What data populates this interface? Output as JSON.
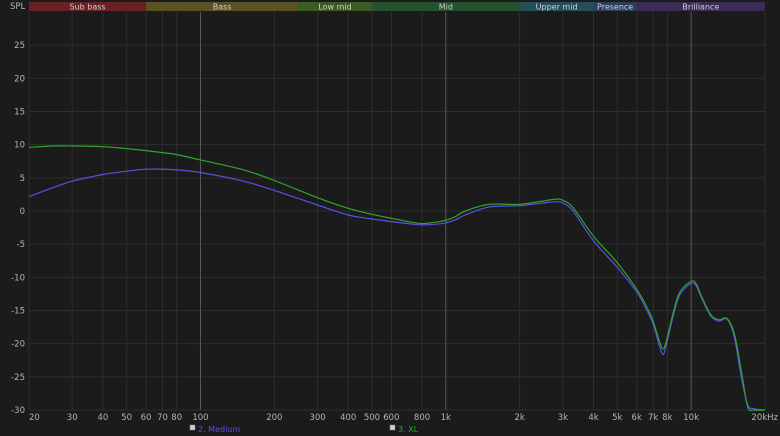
{
  "chart_data": {
    "type": "line",
    "ylabel": "SPL",
    "xscale": "log",
    "xlim": [
      20,
      20000
    ],
    "ylim": [
      -30,
      30
    ],
    "grid": true,
    "bands": [
      {
        "name": "Sub bass",
        "from": 20,
        "to": 60,
        "color": "#6b2026"
      },
      {
        "name": "Bass",
        "from": 60,
        "to": 250,
        "color": "#5a5222"
      },
      {
        "name": "Low mid",
        "from": 250,
        "to": 500,
        "color": "#3b5a24"
      },
      {
        "name": "Mid",
        "from": 500,
        "to": 2000,
        "color": "#24522f"
      },
      {
        "name": "Upper mid",
        "from": 2000,
        "to": 4000,
        "color": "#244f58"
      },
      {
        "name": "Presence",
        "from": 4000,
        "to": 6000,
        "color": "#2b3e5e"
      },
      {
        "name": "Brilliance",
        "from": 6000,
        "to": 20000,
        "color": "#3c2b55"
      }
    ],
    "y_ticks": [
      {
        "value": 25,
        "label": "25"
      },
      {
        "value": 20,
        "label": "20"
      },
      {
        "value": 15,
        "label": "15"
      },
      {
        "value": 10,
        "label": "10"
      },
      {
        "value": 5,
        "label": "5"
      },
      {
        "value": 0,
        "label": "0"
      },
      {
        "value": -5,
        "label": "-5"
      },
      {
        "value": -10,
        "label": "-10"
      },
      {
        "value": -15,
        "label": "-15"
      },
      {
        "value": -20,
        "label": "-20"
      },
      {
        "value": -25,
        "label": "-25"
      },
      {
        "value": -30,
        "label": "-30"
      }
    ],
    "x_ticks": [
      {
        "value": 20,
        "label": "20",
        "major": false
      },
      {
        "value": 30,
        "label": "30",
        "major": false
      },
      {
        "value": 40,
        "label": "40",
        "major": false
      },
      {
        "value": 50,
        "label": "50",
        "major": false
      },
      {
        "value": 60,
        "label": "60",
        "major": false
      },
      {
        "value": 70,
        "label": "70",
        "major": false
      },
      {
        "value": 80,
        "label": "80",
        "major": false
      },
      {
        "value": 100,
        "label": "100",
        "major": true
      },
      {
        "value": 200,
        "label": "200",
        "major": false
      },
      {
        "value": 300,
        "label": "300",
        "major": false
      },
      {
        "value": 400,
        "label": "400",
        "major": false
      },
      {
        "value": 500,
        "label": "500",
        "major": false
      },
      {
        "value": 600,
        "label": "600",
        "major": false
      },
      {
        "value": 800,
        "label": "800",
        "major": false
      },
      {
        "value": 1000,
        "label": "1k",
        "major": true
      },
      {
        "value": 2000,
        "label": "2k",
        "major": false
      },
      {
        "value": 3000,
        "label": "3k",
        "major": false
      },
      {
        "value": 4000,
        "label": "4k",
        "major": false
      },
      {
        "value": 5000,
        "label": "5k",
        "major": false
      },
      {
        "value": 6000,
        "label": "6k",
        "major": false
      },
      {
        "value": 7000,
        "label": "7k",
        "major": false
      },
      {
        "value": 8000,
        "label": "8k",
        "major": false
      },
      {
        "value": 10000,
        "label": "10k",
        "major": true
      },
      {
        "value": 20000,
        "label": "20kHz",
        "major": false
      }
    ],
    "series": [
      {
        "name": "2. Medium",
        "color": "#5b4fe0",
        "x": [
          20,
          25,
          30,
          40,
          50,
          60,
          70,
          80,
          100,
          150,
          200,
          300,
          400,
          500,
          600,
          700,
          800,
          900,
          1000,
          1100,
          1200,
          1500,
          2000,
          2500,
          2800,
          3000,
          3300,
          4000,
          5000,
          6000,
          6500,
          7000,
          7400,
          7700,
          8000,
          8500,
          9000,
          10000,
          10500,
          11000,
          12000,
          13000,
          14000,
          15000,
          16000,
          17000,
          18000,
          20000
        ],
        "y": [
          2.2,
          3.5,
          4.5,
          5.5,
          6.0,
          6.3,
          6.3,
          6.2,
          5.8,
          4.5,
          3.1,
          0.9,
          -0.6,
          -1.2,
          -1.6,
          -1.9,
          -2.1,
          -2.0,
          -1.8,
          -1.3,
          -0.6,
          0.6,
          0.8,
          1.2,
          1.4,
          1.2,
          0.0,
          -4.5,
          -8.5,
          -12.2,
          -14.5,
          -17.0,
          -20.2,
          -21.6,
          -19.5,
          -15.5,
          -12.6,
          -10.9,
          -11.3,
          -13.0,
          -15.8,
          -16.6,
          -16.3,
          -19.0,
          -25.0,
          -29.2,
          -29.8,
          -30.0
        ]
      },
      {
        "name": "3. XL",
        "color": "#2fa52f",
        "x": [
          20,
          25,
          30,
          40,
          50,
          60,
          70,
          80,
          100,
          150,
          200,
          300,
          400,
          500,
          600,
          700,
          800,
          900,
          1000,
          1100,
          1200,
          1500,
          2000,
          2500,
          2800,
          3000,
          3300,
          4000,
          5000,
          6000,
          6500,
          7000,
          7400,
          7700,
          8000,
          8500,
          9000,
          10000,
          10500,
          11000,
          12000,
          13000,
          14000,
          15000,
          16000,
          17000,
          18000,
          20000
        ],
        "y": [
          9.6,
          9.8,
          9.8,
          9.7,
          9.4,
          9.1,
          8.8,
          8.5,
          7.7,
          6.2,
          4.6,
          2.0,
          0.4,
          -0.5,
          -1.1,
          -1.6,
          -1.9,
          -1.7,
          -1.4,
          -0.8,
          0.0,
          1.0,
          1.0,
          1.5,
          1.8,
          1.6,
          0.5,
          -3.8,
          -7.8,
          -11.8,
          -14.0,
          -16.6,
          -19.5,
          -20.8,
          -19.0,
          -15.0,
          -12.2,
          -10.6,
          -11.0,
          -12.8,
          -15.6,
          -16.4,
          -16.2,
          -18.5,
          -24.0,
          -29.5,
          -30.0,
          -30.0
        ]
      }
    ]
  }
}
